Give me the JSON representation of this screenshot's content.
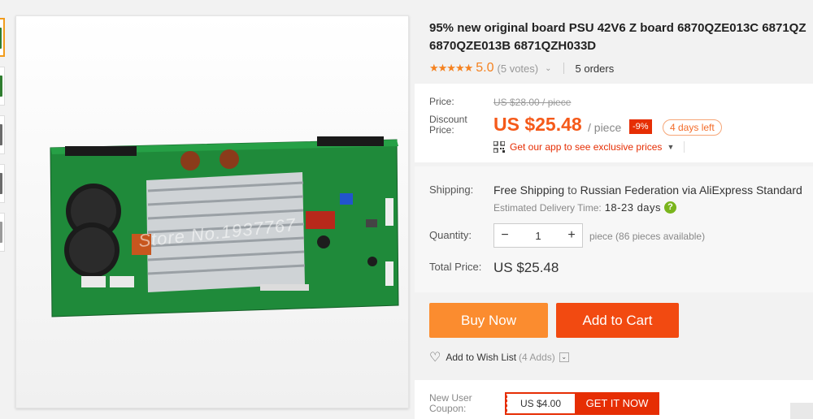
{
  "product": {
    "title_line1": "95% new original board PSU 42V6 Z board 6870QZE013C 6871QZ",
    "title_line2": "6870QZE013B 6871QZH033D",
    "image_watermark": "Store No.1937767"
  },
  "rating": {
    "stars": "★★★★★",
    "score": "5.0",
    "votes": "(5 votes)",
    "orders": "5 orders"
  },
  "price": {
    "price_label": "Price:",
    "original": "US $28.00 / piece",
    "discount_label_1": "Discount",
    "discount_label_2": "Price:",
    "discounted": "US $25.48",
    "unit": "/ piece",
    "percent_off": "-9%",
    "days_left": "4 days left",
    "app_link": "Get our app to see exclusive prices"
  },
  "shipping": {
    "label": "Shipping:",
    "free": "Free Shipping",
    "to": "to",
    "destination": "Russian Federation via AliExpress Standard",
    "delivery_label": "Estimated Delivery Time:",
    "delivery_days": "18-23 days"
  },
  "quantity": {
    "label": "Quantity:",
    "minus": "−",
    "value": "1",
    "plus": "+",
    "available": "piece (86 pieces available)"
  },
  "total": {
    "label": "Total Price:",
    "value": "US $25.48"
  },
  "actions": {
    "buy_now": "Buy Now",
    "add_to_cart": "Add to Cart",
    "wish_list": "Add to Wish List",
    "wish_count": "(4 Adds)"
  },
  "coupon": {
    "label_1": "New User",
    "label_2": "Coupon:",
    "amount": "US $4.00",
    "cta": "GET IT NOW"
  },
  "colors": {
    "accent_orange": "#fb8c2f",
    "accent_red": "#f24a11",
    "price_red": "#f55a1a",
    "star": "#f58220"
  }
}
